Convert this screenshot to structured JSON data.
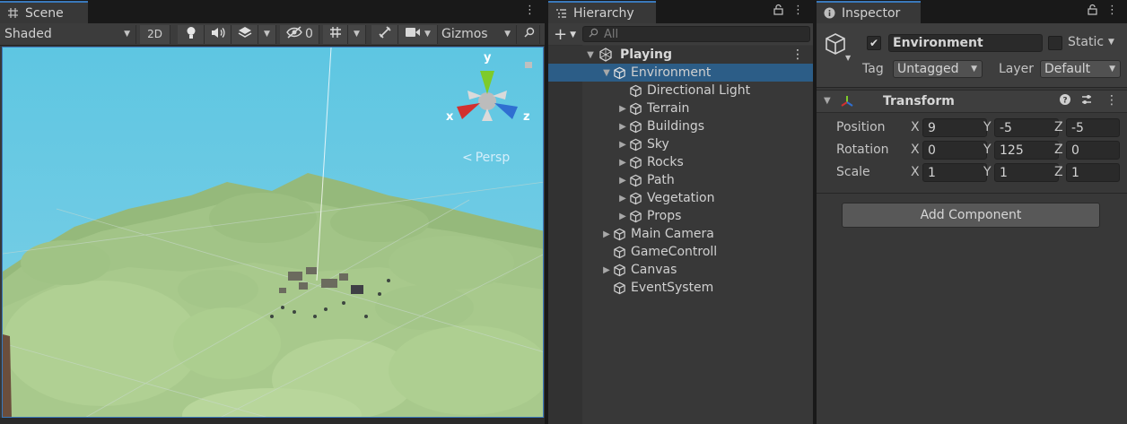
{
  "scene": {
    "tab_label": "Scene",
    "shading_mode": "Shaded",
    "mode_2d": "2D",
    "hidden_count": "0",
    "gizmos_label": "Gizmos",
    "persp_label": "Persp",
    "axis_x": "x",
    "axis_y": "y",
    "axis_z": "z"
  },
  "hierarchy": {
    "tab_label": "Hierarchy",
    "search_placeholder": "All",
    "scene_name": "Playing",
    "items": [
      {
        "label": "Environment",
        "expanded": true,
        "selected": true
      },
      {
        "label": "Directional Light"
      },
      {
        "label": "Terrain"
      },
      {
        "label": "Buildings"
      },
      {
        "label": "Sky"
      },
      {
        "label": "Rocks"
      },
      {
        "label": "Path"
      },
      {
        "label": "Vegetation"
      },
      {
        "label": "Props"
      },
      {
        "label": "Main Camera"
      },
      {
        "label": "GameControll"
      },
      {
        "label": "Canvas"
      },
      {
        "label": "EventSystem"
      }
    ]
  },
  "inspector": {
    "tab_label": "Inspector",
    "object_name": "Environment",
    "active": true,
    "static_label": "Static",
    "tag_label": "Tag",
    "tag_value": "Untagged",
    "layer_label": "Layer",
    "layer_value": "Default",
    "transform": {
      "title": "Transform",
      "position_label": "Position",
      "rotation_label": "Rotation",
      "scale_label": "Scale",
      "x_label": "X",
      "y_label": "Y",
      "z_label": "Z",
      "position": {
        "x": "9",
        "y": "-5",
        "z": "-5"
      },
      "rotation": {
        "x": "0",
        "y": "125",
        "z": "0"
      },
      "scale": {
        "x": "1",
        "y": "1",
        "z": "1"
      }
    },
    "add_component_label": "Add Component"
  },
  "colors": {
    "accent": "#3a79bb",
    "selection": "#2c5d87",
    "panel_bg": "#383838",
    "sky": "#5cc3df",
    "terrain": "#a7c98a"
  }
}
